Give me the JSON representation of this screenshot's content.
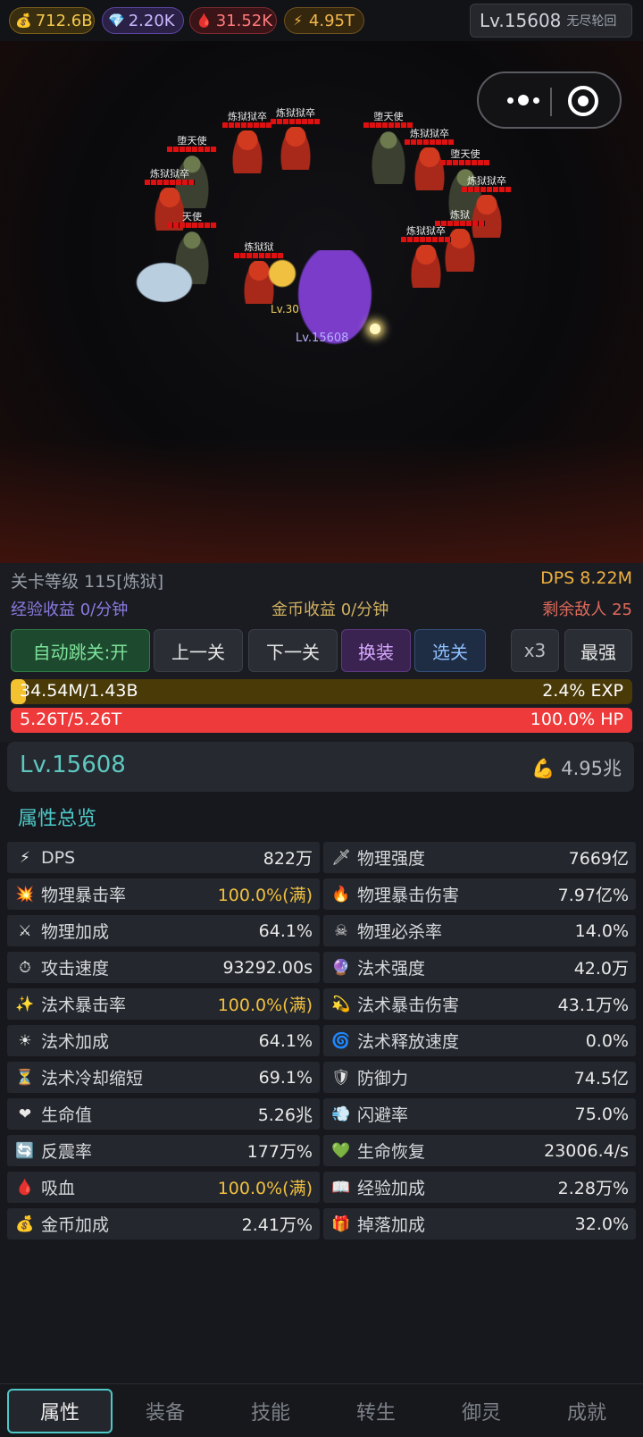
{
  "currencies": {
    "gold": {
      "value": "712.6B",
      "icon": "money-bag-icon",
      "color": "#f2c94c"
    },
    "gem": {
      "value": "2.20K",
      "icon": "diamond-icon",
      "color": "#c9b8ff"
    },
    "blood": {
      "value": "31.52K",
      "icon": "blood-drop-icon",
      "color": "#ff7b7b"
    },
    "power": {
      "value": "4.95T",
      "icon": "lightning-icon",
      "color": "#f2b84c"
    }
  },
  "header": {
    "level": "Lv.15608",
    "mode": "无尽轮回"
  },
  "scene": {
    "enemies": [
      {
        "name": "炼狱狱卒"
      },
      {
        "name": "炼狱狱卒"
      },
      {
        "name": "堕天使"
      },
      {
        "name": "炼狱狱卒"
      },
      {
        "name": "天使"
      },
      {
        "name": "炼狱狱"
      },
      {
        "name": "堕天使"
      },
      {
        "name": "炼狱狱卒"
      },
      {
        "name": "堕天使"
      },
      {
        "name": "炼狱狱卒"
      },
      {
        "name": "炼狱"
      },
      {
        "name": "炼狱狱卒"
      }
    ],
    "hero_level": "Lv.15608",
    "pet_level": "Lv.30"
  },
  "stage": {
    "level_label": "关卡等级 115[炼狱]",
    "dps": "DPS 8.22M",
    "exp_income": "经验收益 0/分钟",
    "gold_income": "金币收益 0/分钟",
    "enemies_left": "剩余敌人 25",
    "buttons": {
      "auto": "自动跳关:开",
      "prev": "上一关",
      "next": "下一关",
      "equip": "换装",
      "select": "选关",
      "speed": "x3",
      "strongest": "最强"
    },
    "exp_bar": {
      "text": "34.54M/1.43B",
      "percent": "2.4% EXP",
      "fill_fraction": 0.024
    },
    "hp_bar": {
      "text": "5.26T/5.26T",
      "percent": "100.0% HP",
      "fill_fraction": 1.0
    }
  },
  "profile": {
    "level": "Lv.15608",
    "power": "4.95兆",
    "power_icon": "flexed-arm-icon"
  },
  "section_title": "属性总览",
  "stats": [
    {
      "icon": "⚡",
      "icon_name": "lightning-icon",
      "name": "DPS",
      "value": "822万",
      "full": false
    },
    {
      "icon": "🗡",
      "icon_name": "dagger-icon",
      "name": "物理强度",
      "value": "7669亿",
      "full": false
    },
    {
      "icon": "💥",
      "icon_name": "burst-icon",
      "name": "物理暴击率",
      "value": "100.0%(满)",
      "full": true
    },
    {
      "icon": "🔥",
      "icon_name": "fire-icon",
      "name": "物理暴击伤害",
      "value": "7.97亿%",
      "full": false
    },
    {
      "icon": "⚔",
      "icon_name": "crossed-swords-icon",
      "name": "物理加成",
      "value": "64.1%",
      "full": false
    },
    {
      "icon": "☠",
      "icon_name": "skull-icon",
      "name": "物理必杀率",
      "value": "14.0%",
      "full": false
    },
    {
      "icon": "⏱",
      "icon_name": "stopwatch-icon",
      "name": "攻击速度",
      "value": "93292.00s",
      "full": false
    },
    {
      "icon": "🔮",
      "icon_name": "crystal-ball-icon",
      "name": "法术强度",
      "value": "42.0万",
      "full": false
    },
    {
      "icon": "✨",
      "icon_name": "sparkles-icon",
      "name": "法术暴击率",
      "value": "100.0%(满)",
      "full": true
    },
    {
      "icon": "💫",
      "icon_name": "dizzy-star-icon",
      "name": "法术暴击伤害",
      "value": "43.1万%",
      "full": false
    },
    {
      "icon": "☀",
      "icon_name": "sun-icon",
      "name": "法术加成",
      "value": "64.1%",
      "full": false
    },
    {
      "icon": "🌀",
      "icon_name": "cyclone-icon",
      "name": "法术释放速度",
      "value": "0.0%",
      "full": false
    },
    {
      "icon": "⏳",
      "icon_name": "hourglass-icon",
      "name": "法术冷却缩短",
      "value": "69.1%",
      "full": false
    },
    {
      "icon": "🛡",
      "icon_name": "shield-icon",
      "name": "防御力",
      "value": "74.5亿",
      "full": false
    },
    {
      "icon": "❤",
      "icon_name": "heart-icon",
      "name": "生命值",
      "value": "5.26兆",
      "full": false
    },
    {
      "icon": "💨",
      "icon_name": "wind-icon",
      "name": "闪避率",
      "value": "75.0%",
      "full": false
    },
    {
      "icon": "🔄",
      "icon_name": "refresh-icon",
      "name": "反震率",
      "value": "177万%",
      "full": false
    },
    {
      "icon": "💚",
      "icon_name": "green-heart-icon",
      "name": "生命恢复",
      "value": "23006.4/s",
      "full": false
    },
    {
      "icon": "🩸",
      "icon_name": "blood-drop-icon",
      "name": "吸血",
      "value": "100.0%(满)",
      "full": true
    },
    {
      "icon": "📖",
      "icon_name": "book-icon",
      "name": "经验加成",
      "value": "2.28万%",
      "full": false
    },
    {
      "icon": "💰",
      "icon_name": "money-bag-icon",
      "name": "金币加成",
      "value": "2.41万%",
      "full": false
    },
    {
      "icon": "🎁",
      "icon_name": "gift-icon",
      "name": "掉落加成",
      "value": "32.0%",
      "full": false
    }
  ],
  "nav": {
    "tabs": [
      "属性",
      "装备",
      "技能",
      "转生",
      "御灵",
      "成就"
    ],
    "active": 0
  },
  "colors": {
    "accent": "#4fc8c8",
    "full_value": "#f0c040",
    "exp": "#f2c230",
    "hp": "#ee3a3a"
  }
}
